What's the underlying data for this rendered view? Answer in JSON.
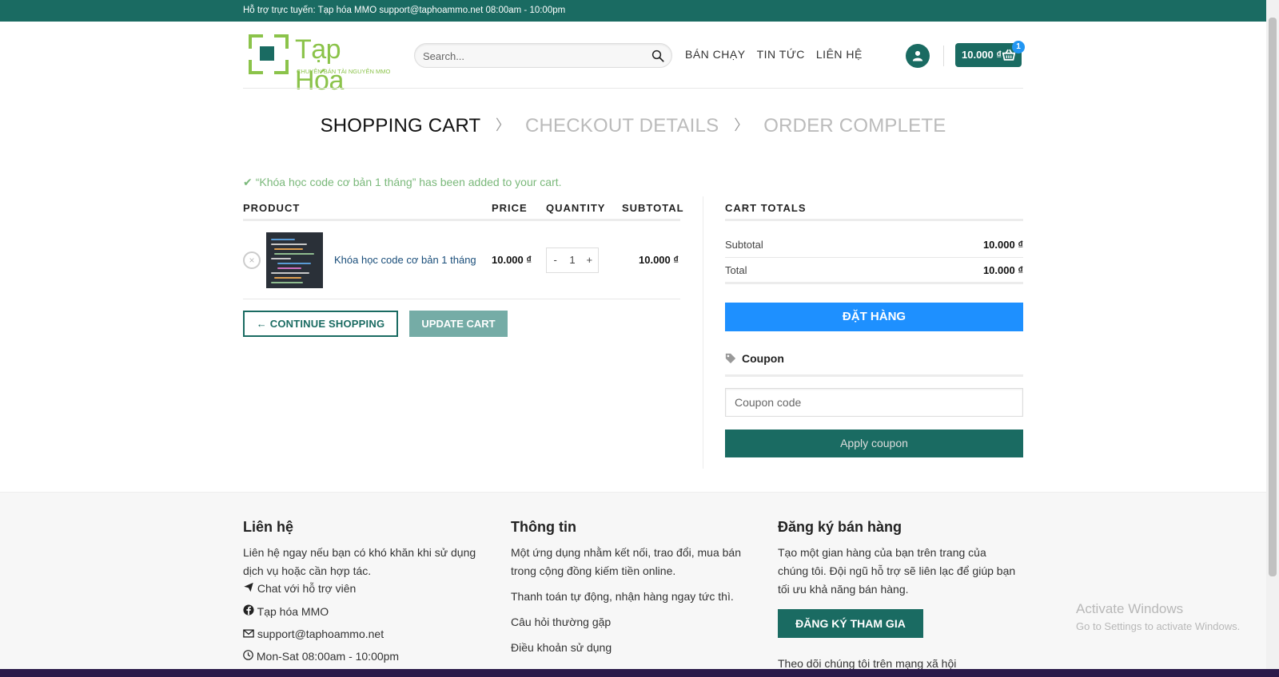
{
  "topbar": {
    "text": "Hỗ trợ trực tuyến: Tạp hóa MMO support@taphoammo.net 08:00am - 10:00pm"
  },
  "logo": {
    "name": "Tạp Hóa",
    "tagline": "CHUYÊN BÁN TÀI NGUYÊN MMO"
  },
  "search": {
    "placeholder": "Search..."
  },
  "nav": {
    "items": [
      "BÁN CHẠY",
      "TIN TỨC",
      "LIÊN HỆ"
    ]
  },
  "cart": {
    "total": "10.000 ₫",
    "count": "1"
  },
  "steps": {
    "cart": "SHOPPING CART",
    "checkout": "CHECKOUT DETAILS",
    "complete": "ORDER COMPLETE"
  },
  "notice": "“Khóa học code cơ bản 1 tháng” has been added to your cart.",
  "table": {
    "headers": {
      "product": "PRODUCT",
      "price": "PRICE",
      "quantity": "QUANTITY",
      "subtotal": "SUBTOTAL"
    },
    "rows": [
      {
        "remove": "×",
        "name": "Khóa học code cơ bản 1 tháng",
        "price": "10.000 ₫",
        "qty_minus": "-",
        "qty": "1",
        "qty_plus": "+",
        "subtotal": "10.000 ₫"
      }
    ]
  },
  "buttons": {
    "continue": "← CONTINUE SHOPPING",
    "update": "UPDATE CART"
  },
  "totals": {
    "title": "CART TOTALS",
    "subtotal_label": "Subtotal",
    "subtotal_value": "10.000 ₫",
    "total_label": "Total",
    "total_value": "10.000 ₫",
    "order_button": "ĐẶT HÀNG",
    "coupon_title": "Coupon",
    "coupon_placeholder": "Coupon code",
    "apply_button": "Apply coupon"
  },
  "footer": {
    "contact": {
      "title": "Liên hệ",
      "desc": "Liên hệ ngay nếu bạn có khó khăn khi sử dụng dịch vụ hoặc cần hợp tác.",
      "chat": "Chat với hỗ trợ viên",
      "facebook": "Tạp hóa MMO",
      "email": "support@taphoammo.net",
      "hours": "Mon-Sat 08:00am - 10:00pm"
    },
    "info": {
      "title": "Thông tin",
      "desc": "Một ứng dụng nhằm kết nối, trao đổi, mua bán trong cộng đồng kiếm tiền online.",
      "payment": "Thanh toán tự động, nhận hàng ngay tức thì.",
      "faq": "Câu hỏi thường gặp",
      "terms": "Điều khoản sử dụng"
    },
    "register": {
      "title": "Đăng ký bán hàng",
      "desc": "Tạo một gian hàng của bạn trên trang của chúng tôi. Đội ngũ hỗ trợ sẽ liên lạc để giúp bạn tối ưu khả năng bán hàng.",
      "button": "ĐĂNG KÝ THAM GIA",
      "follow": "Theo dõi chúng tôi trên mạng xã hội"
    }
  },
  "watermark": {
    "title": "Activate Windows",
    "subtitle": "Go to Settings to activate Windows."
  },
  "colors": {
    "brand": "#1a6b62",
    "accent": "#8bc34a",
    "order": "#1e90ff"
  }
}
